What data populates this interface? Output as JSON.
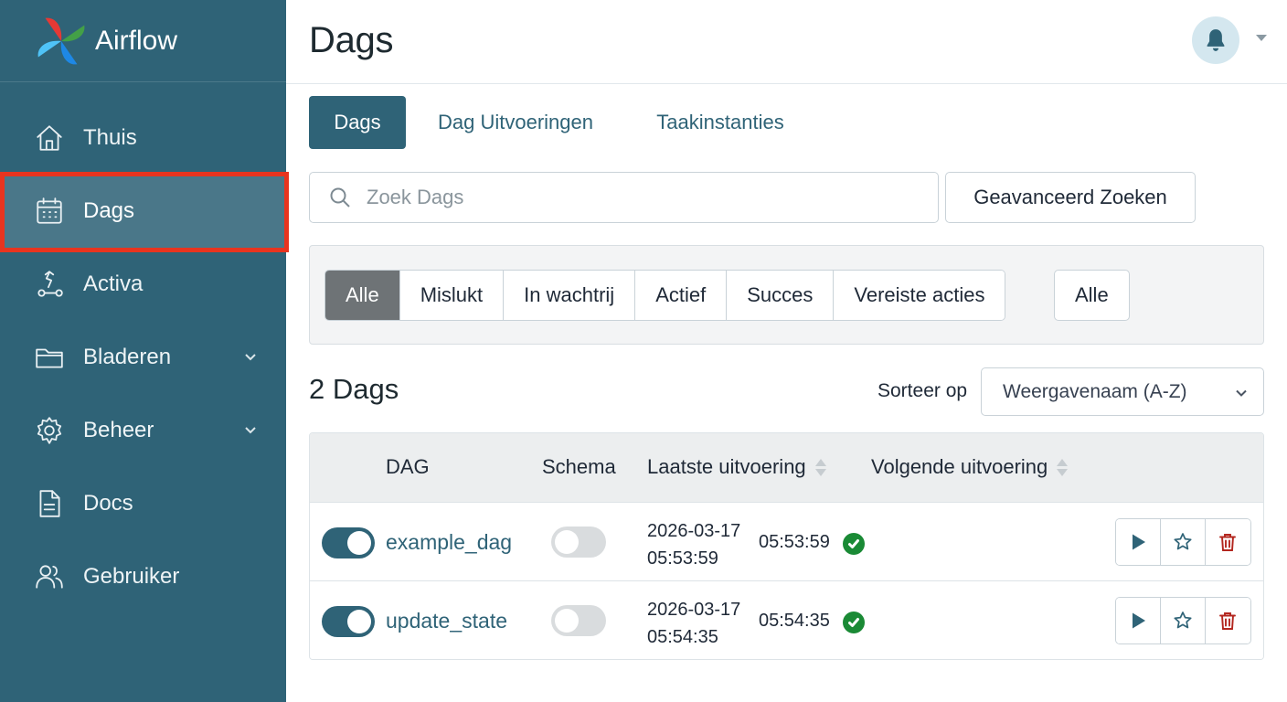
{
  "app": {
    "name": "Airflow"
  },
  "sidebar": {
    "items": [
      {
        "label": "Thuis",
        "icon": "home-icon"
      },
      {
        "label": "Dags",
        "icon": "calendar-icon",
        "active": true
      },
      {
        "label": "Activa",
        "icon": "assets-icon"
      },
      {
        "label": "Bladeren",
        "icon": "folder-icon",
        "expandable": true
      },
      {
        "label": "Beheer",
        "icon": "gear-icon",
        "expandable": true
      },
      {
        "label": "Docs",
        "icon": "document-icon"
      },
      {
        "label": "Gebruiker",
        "icon": "users-icon"
      }
    ]
  },
  "header": {
    "title": "Dags",
    "icon": "bell-icon"
  },
  "tabs": [
    {
      "label": "Dags",
      "active": true
    },
    {
      "label": "Dag Uitvoeringen"
    },
    {
      "label": "Taakinstanties"
    }
  ],
  "search": {
    "placeholder": "Zoek Dags",
    "value": "",
    "advanced_label": "Geavanceerd Zoeken"
  },
  "filters": {
    "buttons": [
      "Alle",
      "Mislukt",
      "In wachtrij",
      "Actief",
      "Succes",
      "Vereiste acties"
    ],
    "active": "Alle",
    "extra": "Alle"
  },
  "list": {
    "count_label": "2 Dags",
    "sort_label": "Sorteer op",
    "sort_value": "Weergavenaam (A-Z)"
  },
  "table": {
    "headers": {
      "dag": "DAG",
      "schedule": "Schema",
      "last_run": "Laatste uitvoering",
      "next_run": "Volgende uitvoering"
    },
    "rows": [
      {
        "name": "example_dag",
        "enabled": true,
        "schedule_on": false,
        "last_run_date": "2026-03-17",
        "last_run_time": "05:53:59",
        "next_run_time": "05:53:59",
        "status": "success"
      },
      {
        "name": "update_state",
        "enabled": true,
        "schedule_on": false,
        "last_run_date": "2026-03-17",
        "last_run_time": "05:54:35",
        "next_run_time": "05:54:35",
        "status": "success"
      }
    ]
  },
  "colors": {
    "sidebar": "#2f6377",
    "accent": "#2f6377",
    "highlight": "#e8341f",
    "success": "#1a8a35",
    "delete": "#b3261e"
  }
}
